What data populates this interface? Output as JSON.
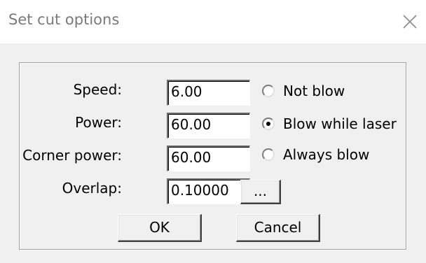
{
  "window": {
    "title": "Set cut options",
    "close_icon": "close-icon"
  },
  "form": {
    "speed": {
      "label": "Speed:",
      "value": "6.00"
    },
    "power": {
      "label": "Power:",
      "value": "60.00"
    },
    "corner_power": {
      "label": "Corner power:",
      "value": "60.00"
    },
    "overlap": {
      "label": "Overlap:",
      "value": "0.10000"
    }
  },
  "blow_mode": {
    "options": [
      {
        "label": "Not blow",
        "selected": false
      },
      {
        "label": "Blow while laser",
        "selected": true
      },
      {
        "label": "Always blow",
        "selected": false
      }
    ]
  },
  "buttons": {
    "browse": "...",
    "ok": "OK",
    "cancel": "Cancel"
  }
}
